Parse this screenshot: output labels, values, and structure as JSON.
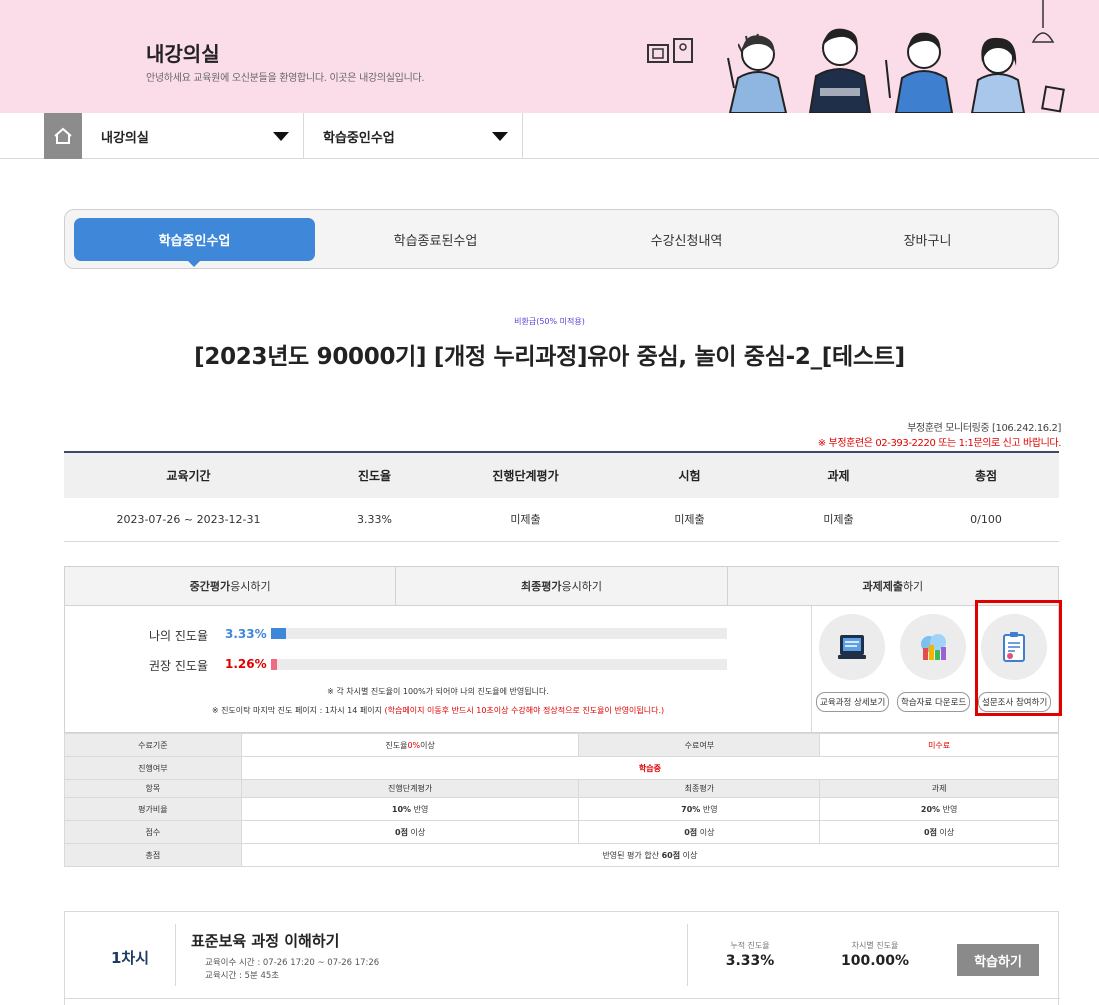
{
  "banner": {
    "title": "내강의실",
    "subtitle": "안녕하세요 교육원에 오신분들을 환영합니다. 이곳은 내강의실입니다."
  },
  "nav": {
    "dropdown1": "내강의실",
    "dropdown2": "학습중인수업"
  },
  "tabs": [
    {
      "label": "학습중인수업",
      "active": true
    },
    {
      "label": "학습종료된수업",
      "active": false
    },
    {
      "label": "수강신청내역",
      "active": false
    },
    {
      "label": "장바구니",
      "active": false
    }
  ],
  "course": {
    "tag": "비환급(50% 미적용)",
    "title": "[2023년도 90000기] [개정 누리과정]유아 중심, 놀이 중심-2_[테스트]"
  },
  "monitor": {
    "text": "부정훈련 모니터링중 [106.242.16.2]",
    "report": "※ 부정훈련은 02-393-2220 또는 1:1문의로 신고 바랍니다."
  },
  "summary": {
    "headers": [
      "교육기간",
      "진도율",
      "진행단계평가",
      "시험",
      "과제",
      "총점"
    ],
    "values": [
      "2023-07-26 ~ 2023-12-31",
      "3.33%",
      "미제출",
      "미제출",
      "미제출",
      "0/100"
    ]
  },
  "eval_buttons": [
    {
      "bold": "중간평가",
      "rest": "응시하기"
    },
    {
      "bold": "최종평가",
      "rest": "응시하기"
    },
    {
      "bold": "과제제출",
      "rest": "하기"
    }
  ],
  "progress": {
    "my_label": "나의 진도율",
    "my_value": "3.33%",
    "my_fraction": 0.0333,
    "rec_label": "권장 진도율",
    "rec_value": "1.26%",
    "rec_fraction": 0.0126,
    "note1": "※ 각 차시별 진도율이 100%가 되어야 나의 진도율에 반영됩니다.",
    "note2_a": "※ 진도이탁 마지막 진도 페이지 : 1차시 14 페이지",
    "note2_b": "(학습페이지 이동후 반드시 10초이상 수강해야 정상적으로 진도율이 반영이됩니다.)",
    "colors": {
      "my": "#3f87d9",
      "rec": "#f06a82"
    }
  },
  "icon_buttons": [
    {
      "label": "교육과정 상세보기",
      "icon": "course-detail-icon"
    },
    {
      "label": "학습자료 다운로드",
      "icon": "download-icon"
    },
    {
      "label": "설문조사 참여하기",
      "icon": "survey-icon"
    }
  ],
  "criteria": {
    "completion_label": "수료기준",
    "completion_pre": "진도율",
    "completion_red": "0%",
    "completion_post": "이상",
    "status_label": "수료여부",
    "status_value": "미수료",
    "progress_label": "진행여부",
    "progress_value": "학습중",
    "item_label": "항목",
    "items": [
      "진행단계평가",
      "최종평가",
      "과제"
    ],
    "ratio_label": "평가비율",
    "ratio_bold": [
      "10%",
      "70%",
      "20%"
    ],
    "ratio_suffix": "반영",
    "score_label": "점수",
    "score_bold": [
      "0점",
      "0점",
      "0점"
    ],
    "score_suffix": "이상",
    "total_label": "총점",
    "total_pre": "반영된 평가 합산",
    "total_bold": "60점",
    "total_post": "이상"
  },
  "lesson": {
    "number": "1차시",
    "title": "표준보육 과정 이해하기",
    "time_label": "교육이수 시간 : 07-26 17:20 ~ 07-26 17:26",
    "duration_label": "교육시간 : 5분 45초",
    "cum_label": "누적 진도율",
    "cum_value": "3.33%",
    "each_label": "차시별 진도율",
    "each_value": "100.00%",
    "button": "학습하기"
  }
}
